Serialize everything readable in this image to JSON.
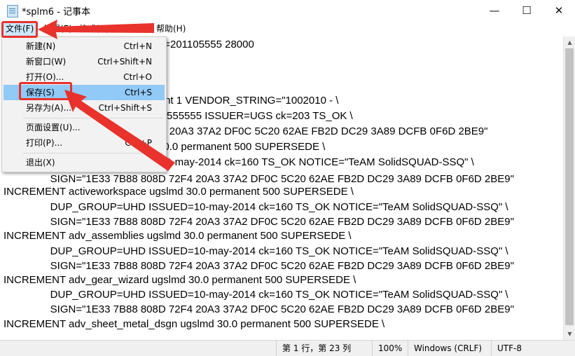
{
  "window": {
    "title": "*splm6 - 记事本",
    "minimize": "—",
    "maximize": "☐",
    "close": "✕"
  },
  "menu": {
    "file": "文件(F)",
    "edit": "编辑(E)",
    "format": "格式(O)",
    "view": "查看(V)",
    "help": "帮助(H)"
  },
  "file_menu": {
    "items": [
      {
        "label": "新建(N)",
        "shortcut": "Ctrl+N"
      },
      {
        "label": "新窗口(W)",
        "shortcut": "Ctrl+Shift+N"
      },
      {
        "label": "打开(O)...",
        "shortcut": "Ctrl+O"
      },
      {
        "label": "保存(S)",
        "shortcut": "Ctrl+S"
      },
      {
        "label": "另存为(A)...",
        "shortcut": "Ctrl+Shift+S"
      },
      {
        "label": "页面设置(U)...",
        "shortcut": ""
      },
      {
        "label": "打印(P)...",
        "shortcut": "Ctrl+P"
      },
      {
        "label": "退出(X)",
        "shortcut": ""
      }
    ],
    "highlighted": "保存(S)"
  },
  "editor": {
    "lines": [
      "                                                       =201105555 28000",
      "",
      "",
      "                                      0 permanent 1 VENDOR_STRING=\"1002010 - \\",
      "                                      _info=5555555555 ISSUER=UGS ck=203 TS_OK \\",
      "                                      808D 72F4 20A3 37A2 DF0C 5C20 62AE FB2D DC29 3A89 DCFB 0F6D 2BE9\"",
      "                                      r ugslmd 30.0 permanent 500 SUPERSEDE \\",
      "                                      ISSUED=10-may-2014 ck=160 TS_OK NOTICE=\"TeAM SolidSQUAD-SSQ\" \\",
      "                SIGN=\"1E33 7B88 808D 72F4 20A3 37A2 DF0C 5C20 62AE FB2D DC29 3A89 DCFB 0F6D 2BE9\"",
      "INCREMENT activeworkspace ugslmd 30.0 permanent 500 SUPERSEDE \\",
      "                DUP_GROUP=UHD ISSUED=10-may-2014 ck=160 TS_OK NOTICE=\"TeAM SolidSQUAD-SSQ\" \\",
      "                SIGN=\"1E33 7B88 808D 72F4 20A3 37A2 DF0C 5C20 62AE FB2D DC29 3A89 DCFB 0F6D 2BE9\"",
      "INCREMENT adv_assemblies ugslmd 30.0 permanent 500 SUPERSEDE \\",
      "                DUP_GROUP=UHD ISSUED=10-may-2014 ck=160 TS_OK NOTICE=\"TeAM SolidSQUAD-SSQ\" \\",
      "                SIGN=\"1E33 7B88 808D 72F4 20A3 37A2 DF0C 5C20 62AE FB2D DC29 3A89 DCFB 0F6D 2BE9\"",
      "INCREMENT adv_gear_wizard ugslmd 30.0 permanent 500 SUPERSEDE \\",
      "                DUP_GROUP=UHD ISSUED=10-may-2014 ck=160 TS_OK NOTICE=\"TeAM SolidSQUAD-SSQ\" \\",
      "                SIGN=\"1E33 7B88 808D 72F4 20A3 37A2 DF0C 5C20 62AE FB2D DC29 3A89 DCFB 0F6D 2BE9\"",
      "INCREMENT adv_sheet_metal_dsgn ugslmd 30.0 permanent 500 SUPERSEDE \\"
    ]
  },
  "status": {
    "position": "第 1 行，第 23 列",
    "zoom": "100%",
    "line_ending": "Windows (CRLF)",
    "encoding": "UTF-8"
  },
  "colors": {
    "annotation": "#e8322b",
    "menu_highlight": "#91c9f7"
  }
}
